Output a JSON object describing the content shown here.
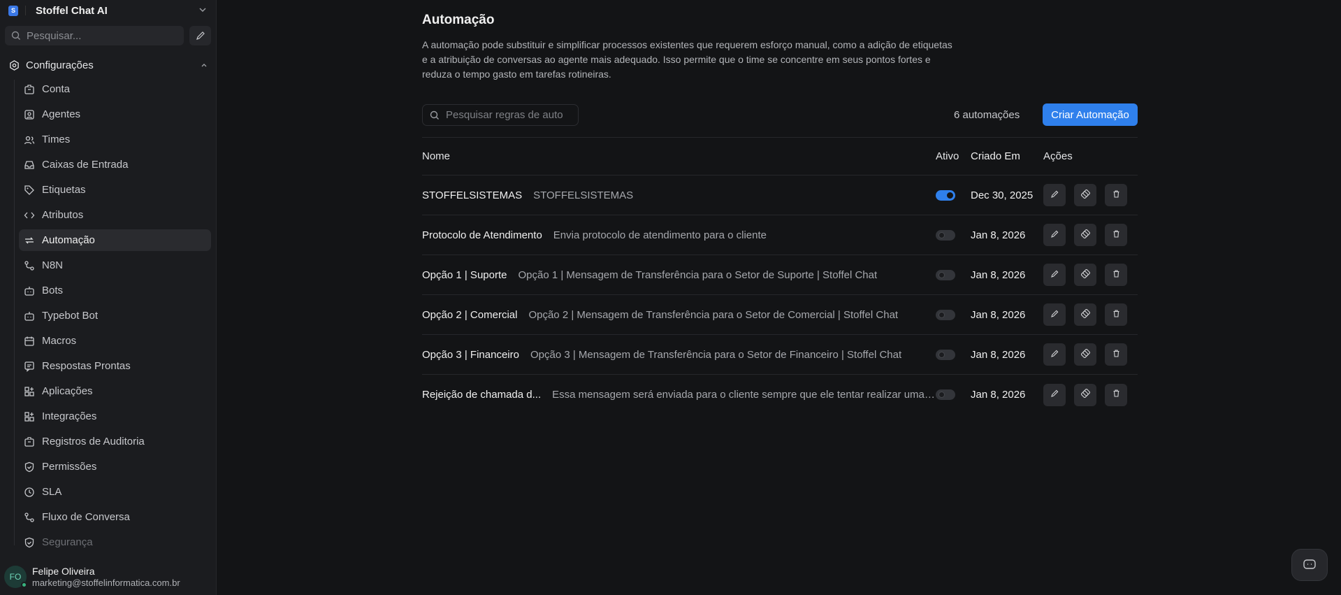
{
  "app": {
    "name": "Stoffel Chat AI",
    "logo_letter": "S"
  },
  "sidebar": {
    "search_placeholder": "Pesquisar...",
    "section_title": "Configurações",
    "items": [
      {
        "label": "Conta",
        "icon": "building-icon"
      },
      {
        "label": "Agentes",
        "icon": "user-square-icon"
      },
      {
        "label": "Times",
        "icon": "users-icon"
      },
      {
        "label": "Caixas de Entrada",
        "icon": "inbox-icon"
      },
      {
        "label": "Etiquetas",
        "icon": "tag-icon"
      },
      {
        "label": "Atributos",
        "icon": "code-icon"
      },
      {
        "label": "Automação",
        "icon": "repeat-icon",
        "active": true
      },
      {
        "label": "N8N",
        "icon": "flow-icon"
      },
      {
        "label": "Bots",
        "icon": "bot-icon"
      },
      {
        "label": "Typebot Bot",
        "icon": "bot-icon"
      },
      {
        "label": "Macros",
        "icon": "calendar-icon"
      },
      {
        "label": "Respostas Prontas",
        "icon": "message-icon"
      },
      {
        "label": "Aplicações",
        "icon": "apps-icon"
      },
      {
        "label": "Integrações",
        "icon": "apps-icon"
      },
      {
        "label": "Registros de Auditoria",
        "icon": "building-icon"
      },
      {
        "label": "Permissões",
        "icon": "shield-icon"
      },
      {
        "label": "SLA",
        "icon": "clock-icon"
      },
      {
        "label": "Fluxo de Conversa",
        "icon": "flow-icon"
      },
      {
        "label": "Segurança",
        "icon": "shield-icon"
      }
    ]
  },
  "user": {
    "initials": "FO",
    "name": "Felipe Oliveira",
    "email": "marketing@stoffelinformatica.com.br"
  },
  "main": {
    "title": "Automação",
    "description": "A automação pode substituir e simplificar processos existentes que requerem esforço manual, como a adição de etiquetas e a atribuição de conversas ao agente mais adequado. Isso permite que o time se concentre em seus pontos fortes e reduza o tempo gasto em tarefas rotineiras.",
    "search_placeholder": "Pesquisar regras de auto",
    "count_label": "6 automações",
    "create_button": "Criar Automação",
    "columns": {
      "name": "Nome",
      "active": "Ativo",
      "created": "Criado Em",
      "actions": "Ações"
    },
    "rows": [
      {
        "name": "STOFFELSISTEMAS",
        "description": "STOFFELSISTEMAS",
        "active": true,
        "created": "Dec 30, 2025"
      },
      {
        "name": "Protocolo de Atendimento",
        "description": "Envia protocolo de atendimento para o cliente",
        "active": false,
        "created": "Jan 8, 2026"
      },
      {
        "name": "Opção 1 | Suporte",
        "description": "Opção 1 | Mensagem de Transferência para o Setor de Suporte | Stoffel Chat",
        "active": false,
        "created": "Jan 8, 2026"
      },
      {
        "name": "Opção 2 | Comercial",
        "description": "Opção 2 | Mensagem de Transferência para o Setor de Comercial | Stoffel Chat",
        "active": false,
        "created": "Jan 8, 2026"
      },
      {
        "name": "Opção 3 | Financeiro",
        "description": "Opção 3 | Mensagem de Transferência para o Setor de Financeiro | Stoffel Chat",
        "active": false,
        "created": "Jan 8, 2026"
      },
      {
        "name": "Rejeição de chamada d...",
        "description": "Essa mensagem será enviada para o cliente sempre que ele tentar realizar uma ch...",
        "active": false,
        "created": "Jan 8, 2026"
      }
    ]
  },
  "colors": {
    "accent": "#2f80ec",
    "bg": "#131416",
    "sidebar_bg": "#1b1c1f"
  }
}
